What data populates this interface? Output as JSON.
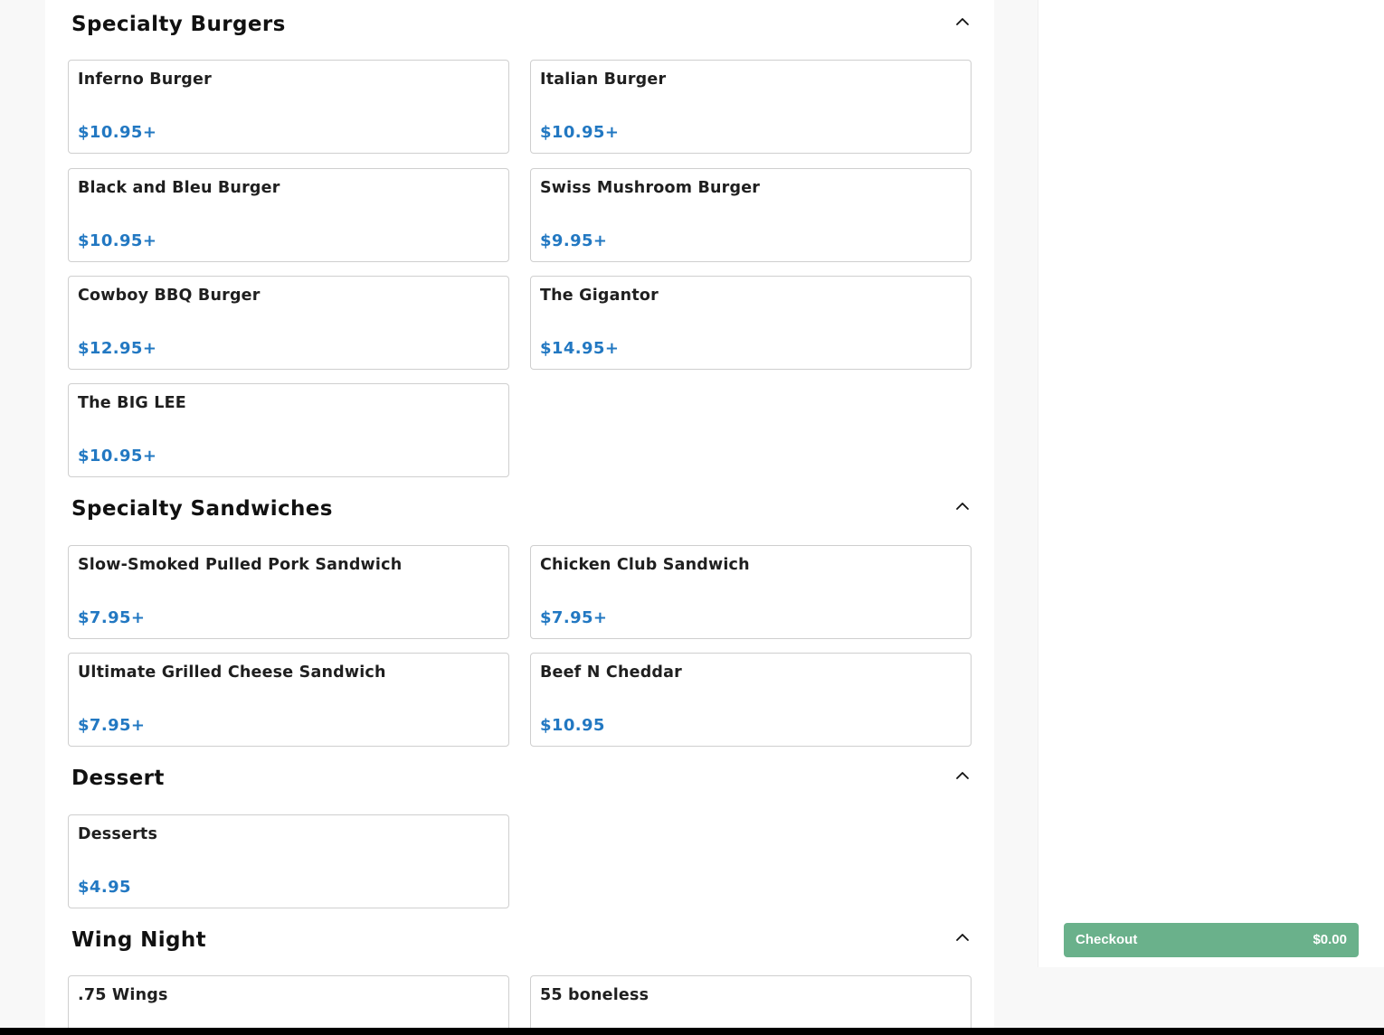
{
  "sections": [
    {
      "title": "Specialty Burgers",
      "items": [
        {
          "name": "Inferno Burger",
          "price": "$10.95+"
        },
        {
          "name": "Italian Burger",
          "price": "$10.95+"
        },
        {
          "name": "Black and Bleu Burger",
          "price": "$10.95+"
        },
        {
          "name": "Swiss Mushroom Burger",
          "price": "$9.95+"
        },
        {
          "name": "Cowboy BBQ Burger",
          "price": "$12.95+"
        },
        {
          "name": "The Gigantor",
          "price": "$14.95+"
        },
        {
          "name": "The BIG LEE",
          "price": "$10.95+"
        }
      ]
    },
    {
      "title": "Specialty Sandwiches",
      "items": [
        {
          "name": "Slow-Smoked Pulled Pork Sandwich",
          "price": "$7.95+"
        },
        {
          "name": "Chicken Club Sandwich",
          "price": "$7.95+"
        },
        {
          "name": "Ultimate Grilled Cheese Sandwich",
          "price": "$7.95+"
        },
        {
          "name": "Beef N Cheddar",
          "price": "$10.95"
        }
      ]
    },
    {
      "title": "Dessert",
      "items": [
        {
          "name": "Desserts",
          "price": "$4.95"
        }
      ]
    },
    {
      "title": "Wing Night",
      "items": [
        {
          "name": ".75 Wings",
          "price": ""
        },
        {
          "name": "55 boneless",
          "price": ""
        }
      ]
    }
  ],
  "cart": {
    "checkout_label": "Checkout",
    "total": "$0.00"
  },
  "colors": {
    "price": "#2278c2",
    "checkout": "#6ab18b"
  },
  "icons": {
    "collapse": "chevron-up-icon"
  }
}
